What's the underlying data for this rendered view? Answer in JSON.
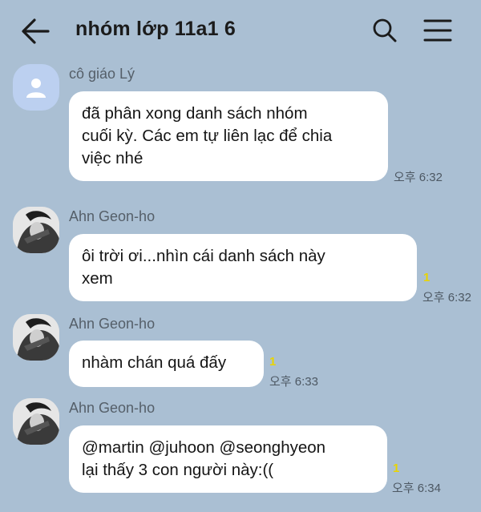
{
  "header": {
    "title": "nhóm lớp 11a1 6",
    "back_icon": "arrow-left-icon",
    "search_icon": "search-icon",
    "menu_icon": "hamburger-menu-icon"
  },
  "colors": {
    "background": "#aabfd3",
    "bubble": "#ffffff",
    "unread": "#e9d400",
    "default_avatar": "#bcd0f0"
  },
  "messages": [
    {
      "sender": "cô giáo Lý",
      "avatar": "default-person-icon",
      "text": "đã phân xong danh sách nhóm\ncuối kỳ. Các em tự liên lạc để chia\nviệc nhé",
      "time": "오후 6:32",
      "unread": ""
    },
    {
      "sender": "Ahn Geon-ho",
      "avatar": "profile-photo",
      "text": "ôi trời ơi...nhìn cái danh sách này\nxem",
      "time": "오후 6:32",
      "unread": "1"
    },
    {
      "sender": "Ahn Geon-ho",
      "avatar": "profile-photo",
      "text": "nhàm chán quá đấy",
      "time": "오후 6:33",
      "unread": "1"
    },
    {
      "sender": "Ahn Geon-ho",
      "avatar": "profile-photo",
      "text": "@martin @juhoon @seonghyeon\nlại thấy 3 con người này:((",
      "time": "오후 6:34",
      "unread": "1"
    }
  ]
}
